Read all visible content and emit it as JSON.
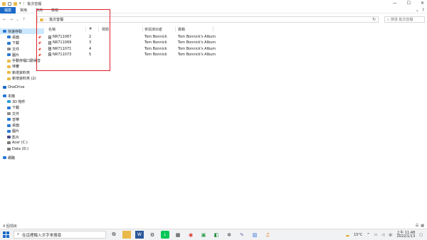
{
  "window": {
    "title": "批次音檔",
    "controls": {
      "minimize": "—",
      "maximize": "☐",
      "close": "✕"
    }
  },
  "ribbon": {
    "tabs": [
      "檔案",
      "常用",
      "共用",
      "檢視"
    ],
    "expand_icon": "⌄",
    "help_icon": "?"
  },
  "address": {
    "path": "批次音檔",
    "search_placeholder": "搜尋 批次音檔"
  },
  "sidebar": {
    "items": [
      {
        "label": "快速存取",
        "icon": "star-icon",
        "color": "#2a78d6",
        "selected": true,
        "pinned": false
      },
      {
        "label": "桌面",
        "icon": "desktop-icon",
        "color": "#2a78d6",
        "pinned": true
      },
      {
        "label": "下載",
        "icon": "download-icon",
        "color": "#2a78d6",
        "pinned": true
      },
      {
        "label": "文件",
        "icon": "documents-icon",
        "color": "#8a8a8a",
        "pinned": true
      },
      {
        "label": "圖片",
        "icon": "pictures-icon",
        "color": "#2a78d6",
        "pinned": true
      },
      {
        "label": "手動存檔口勤得音",
        "icon": "folder-icon",
        "color": "#e9b949",
        "pinned": false
      },
      {
        "label": "待審",
        "icon": "folder-icon",
        "color": "#e9b949",
        "pinned": false
      },
      {
        "label": "新增資料夾",
        "icon": "folder-icon",
        "color": "#e9b949",
        "pinned": false
      },
      {
        "label": "新增資料夾 (2)",
        "icon": "folder-icon",
        "color": "#e9b949",
        "pinned": false
      },
      {
        "label": "OneDrive",
        "icon": "cloud-icon",
        "color": "#1b6ac9",
        "pinned": false
      },
      {
        "label": "本機",
        "icon": "computer-icon",
        "color": "#2a78d6",
        "pinned": false
      },
      {
        "label": "3D 物件",
        "icon": "cube-icon",
        "color": "#2a9fd6",
        "pinned": false
      },
      {
        "label": "下載",
        "icon": "download-icon",
        "color": "#2a78d6",
        "pinned": false
      },
      {
        "label": "文件",
        "icon": "documents-icon",
        "color": "#8a8a8a",
        "pinned": false
      },
      {
        "label": "音樂",
        "icon": "music-icon",
        "color": "#2a78d6",
        "pinned": false
      },
      {
        "label": "桌面",
        "icon": "desktop-icon",
        "color": "#2a78d6",
        "pinned": false
      },
      {
        "label": "圖片",
        "icon": "pictures-icon",
        "color": "#2a78d6",
        "pinned": false
      },
      {
        "label": "影片",
        "icon": "video-icon",
        "color": "#4a4a8a",
        "pinned": false
      },
      {
        "label": "Acer (C:)",
        "icon": "drive-icon",
        "color": "#7a7a7a",
        "pinned": false
      },
      {
        "label": "Data (D:)",
        "icon": "drive-icon",
        "color": "#7a7a7a",
        "pinned": false
      },
      {
        "label": "網路",
        "icon": "network-icon",
        "color": "#2a78d6",
        "pinned": false
      }
    ]
  },
  "table": {
    "columns": [
      "名稱",
      "#",
      "標題",
      "參與演出者",
      "專輯"
    ],
    "rows": [
      {
        "name": "NR711067",
        "num": "2",
        "title": "",
        "artist": "Tom Bonnick",
        "album": "Tom Bonnick's Album"
      },
      {
        "name": "NR711069",
        "num": "3",
        "title": "",
        "artist": "Tom Bonnick",
        "album": "Tom Bonnick's Album"
      },
      {
        "name": "NR711071",
        "num": "4",
        "title": "",
        "artist": "Tom Bonnick",
        "album": "Tom Bonnick's Album"
      },
      {
        "name": "NR711073",
        "num": "5",
        "title": "",
        "artist": "Tom Bonnick",
        "album": "Tom Bonnick's Album"
      }
    ]
  },
  "status": {
    "count_text": "4 個項目"
  },
  "taskbar": {
    "search_placeholder": "在這裡輸入文字來搜尋",
    "temperature": "15°C",
    "ime": "中",
    "time": "上午 11:48",
    "date": "2022/1/13"
  },
  "colors": {
    "accent": "#1b6ac9",
    "highlight_box": "#e0202a",
    "selected_bg": "#cce8ff"
  }
}
